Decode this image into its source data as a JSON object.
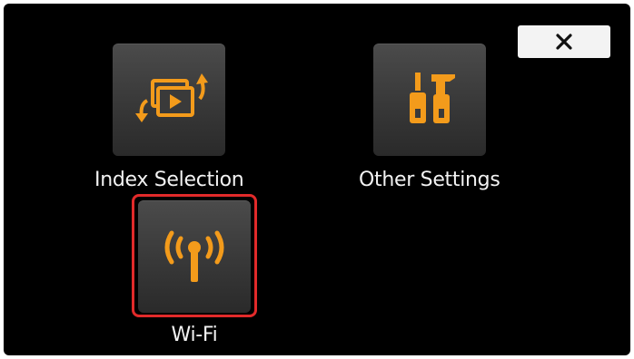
{
  "screen": {
    "close_button": {
      "icon": "close-icon",
      "glyph": "✕"
    },
    "menu_items": [
      {
        "label": "Index Selection",
        "icon": "index-selection-icon"
      },
      {
        "label": "Other Settings",
        "icon": "tools-icon"
      },
      {
        "label": "Wi-Fi",
        "icon": "wifi-antenna-icon",
        "selected": true
      }
    ]
  },
  "colors": {
    "background": "#000000",
    "icon_accent": "#f39b1b",
    "selection_border": "#e22a2a",
    "label_text": "#f2f2f2",
    "close_button_bg": "#f3f3f3"
  }
}
